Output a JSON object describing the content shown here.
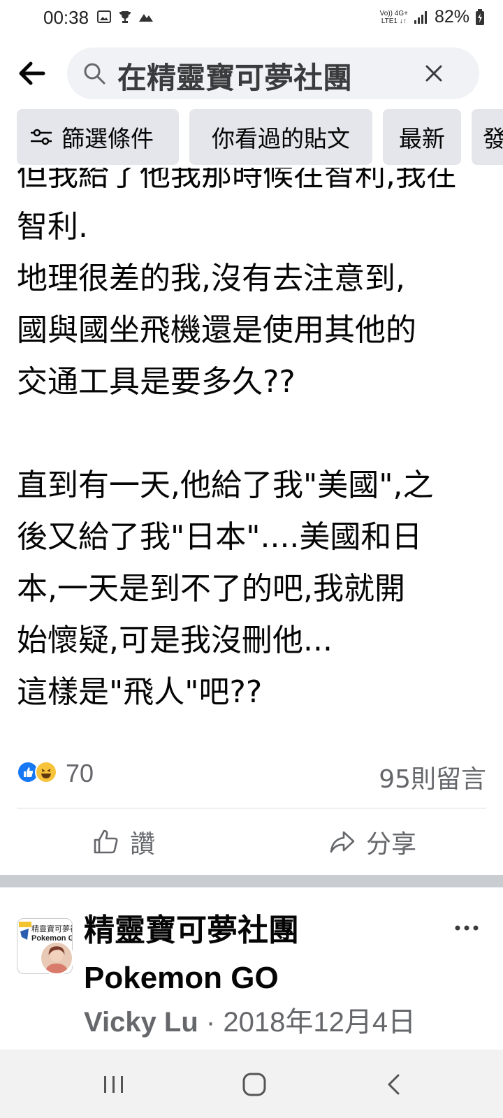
{
  "status_bar": {
    "time": "00:38",
    "network_top": "Vo)) 4G+",
    "network_bottom": "LTE1 ↓↑",
    "battery": "82%"
  },
  "search": {
    "query": "在精靈寶可夢社團"
  },
  "filters": [
    {
      "label": "篩選條件"
    },
    {
      "label": "你看過的貼文"
    },
    {
      "label": "最新"
    },
    {
      "label": "發"
    }
  ],
  "post": {
    "cut_line": "但我給了他我那時候在智利,我在",
    "text": "智利.\n地理很差的我,沒有去注意到,\n國與國坐飛機還是使用其他的\n交通工具是要多久??\n\n直到有一天,他給了我\"美國\",之\n後又給了我\"日本\"....美國和日\n本,一天是到不了的吧,我就開\n始懷疑,可是我沒刪他...\n這樣是\"飛人\"吧??",
    "reaction_count": "70",
    "comment_count": "95則留言",
    "like_label": "讚",
    "share_label": "分享"
  },
  "next_post": {
    "group_name_line1": "精靈寶可夢社團",
    "group_name_line2": "Pokemon GO",
    "avatar_text1": "精靈寶可夢社",
    "avatar_text2": "Pokemon G",
    "author": "Vicky Lu",
    "separator": " · ",
    "date": "2018年12月4日"
  },
  "colors": {
    "search_bg": "#f0f2f5",
    "chip_bg": "#e4e6eb",
    "secondary_text": "#65676b",
    "like_blue": "#1877f2",
    "haha_yellow": "#f7c33b",
    "section_separator": "#c9ccd1"
  }
}
